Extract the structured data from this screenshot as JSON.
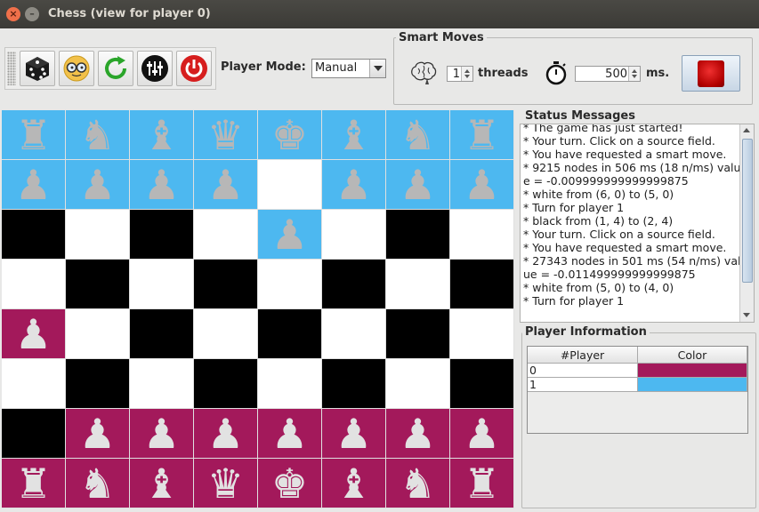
{
  "window": {
    "title": "Chess (view for player 0)"
  },
  "toolbar": {
    "buttons": [
      "dice-icon",
      "glasses-face-icon",
      "refresh-icon",
      "equalizer-icon",
      "power-icon"
    ]
  },
  "player_mode": {
    "label": "Player Mode:",
    "value": "Manual"
  },
  "smart_moves": {
    "legend": "Smart Moves",
    "threads_value": "1",
    "threads_label": "threads",
    "time_value": "500",
    "time_unit": "ms."
  },
  "colors": {
    "player0": "#a3195b",
    "player1": "#4db8f0",
    "dark_square": "#000000",
    "light_square": "#ffffff"
  },
  "board": {
    "rows": [
      [
        {
          "bg": "b",
          "p": "♜"
        },
        {
          "bg": "b",
          "p": "♞"
        },
        {
          "bg": "b",
          "p": "♝"
        },
        {
          "bg": "b",
          "p": "♛"
        },
        {
          "bg": "b",
          "p": "♚"
        },
        {
          "bg": "b",
          "p": "♝"
        },
        {
          "bg": "b",
          "p": "♞"
        },
        {
          "bg": "b",
          "p": "♜"
        }
      ],
      [
        {
          "bg": "b",
          "p": "♟"
        },
        {
          "bg": "b",
          "p": "♟"
        },
        {
          "bg": "b",
          "p": "♟"
        },
        {
          "bg": "b",
          "p": "♟"
        },
        {
          "bg": "w",
          "p": ""
        },
        {
          "bg": "b",
          "p": "♟"
        },
        {
          "bg": "b",
          "p": "♟"
        },
        {
          "bg": "b",
          "p": "♟"
        }
      ],
      [
        {
          "bg": "k",
          "p": ""
        },
        {
          "bg": "w",
          "p": ""
        },
        {
          "bg": "k",
          "p": ""
        },
        {
          "bg": "w",
          "p": ""
        },
        {
          "bg": "b",
          "p": "♟"
        },
        {
          "bg": "w",
          "p": ""
        },
        {
          "bg": "k",
          "p": ""
        },
        {
          "bg": "w",
          "p": ""
        }
      ],
      [
        {
          "bg": "w",
          "p": ""
        },
        {
          "bg": "k",
          "p": ""
        },
        {
          "bg": "w",
          "p": ""
        },
        {
          "bg": "k",
          "p": ""
        },
        {
          "bg": "w",
          "p": ""
        },
        {
          "bg": "k",
          "p": ""
        },
        {
          "bg": "w",
          "p": ""
        },
        {
          "bg": "k",
          "p": ""
        }
      ],
      [
        {
          "bg": "r",
          "p": "♟"
        },
        {
          "bg": "w",
          "p": ""
        },
        {
          "bg": "k",
          "p": ""
        },
        {
          "bg": "w",
          "p": ""
        },
        {
          "bg": "k",
          "p": ""
        },
        {
          "bg": "w",
          "p": ""
        },
        {
          "bg": "k",
          "p": ""
        },
        {
          "bg": "w",
          "p": ""
        }
      ],
      [
        {
          "bg": "w",
          "p": ""
        },
        {
          "bg": "k",
          "p": ""
        },
        {
          "bg": "w",
          "p": ""
        },
        {
          "bg": "k",
          "p": ""
        },
        {
          "bg": "w",
          "p": ""
        },
        {
          "bg": "k",
          "p": ""
        },
        {
          "bg": "w",
          "p": ""
        },
        {
          "bg": "k",
          "p": ""
        }
      ],
      [
        {
          "bg": "k",
          "p": ""
        },
        {
          "bg": "r",
          "p": "♟"
        },
        {
          "bg": "r",
          "p": "♟"
        },
        {
          "bg": "r",
          "p": "♟"
        },
        {
          "bg": "r",
          "p": "♟"
        },
        {
          "bg": "r",
          "p": "♟"
        },
        {
          "bg": "r",
          "p": "♟"
        },
        {
          "bg": "r",
          "p": "♟"
        }
      ],
      [
        {
          "bg": "r",
          "p": "♜"
        },
        {
          "bg": "r",
          "p": "♞"
        },
        {
          "bg": "r",
          "p": "♝"
        },
        {
          "bg": "r",
          "p": "♛"
        },
        {
          "bg": "r",
          "p": "♚"
        },
        {
          "bg": "r",
          "p": "♝"
        },
        {
          "bg": "r",
          "p": "♞"
        },
        {
          "bg": "r",
          "p": "♜"
        }
      ]
    ]
  },
  "status": {
    "legend": "Status Messages",
    "lines": [
      "* The game has just started!",
      "* Your turn. Click on a source field.",
      "* You have requested a smart move.",
      "* 9215 nodes in 506 ms (18 n/ms) valu",
      "e = -0.009999999999999875",
      "* white from (6, 0) to (5, 0)",
      "* Turn for player 1",
      "* black from (1, 4) to (2, 4)",
      "* Your turn. Click on a source field.",
      "* You have requested a smart move.",
      "* 27343 nodes in 501 ms (54 n/ms) val",
      "ue = -0.011499999999999875",
      "* white from (5, 0) to (4, 0)",
      "* Turn for player 1"
    ]
  },
  "player_info": {
    "legend": "Player Information",
    "columns": [
      "#Player",
      "Color"
    ],
    "rows": [
      {
        "player": "0",
        "color": "#a3195b"
      },
      {
        "player": "1",
        "color": "#4db8f0"
      }
    ]
  }
}
